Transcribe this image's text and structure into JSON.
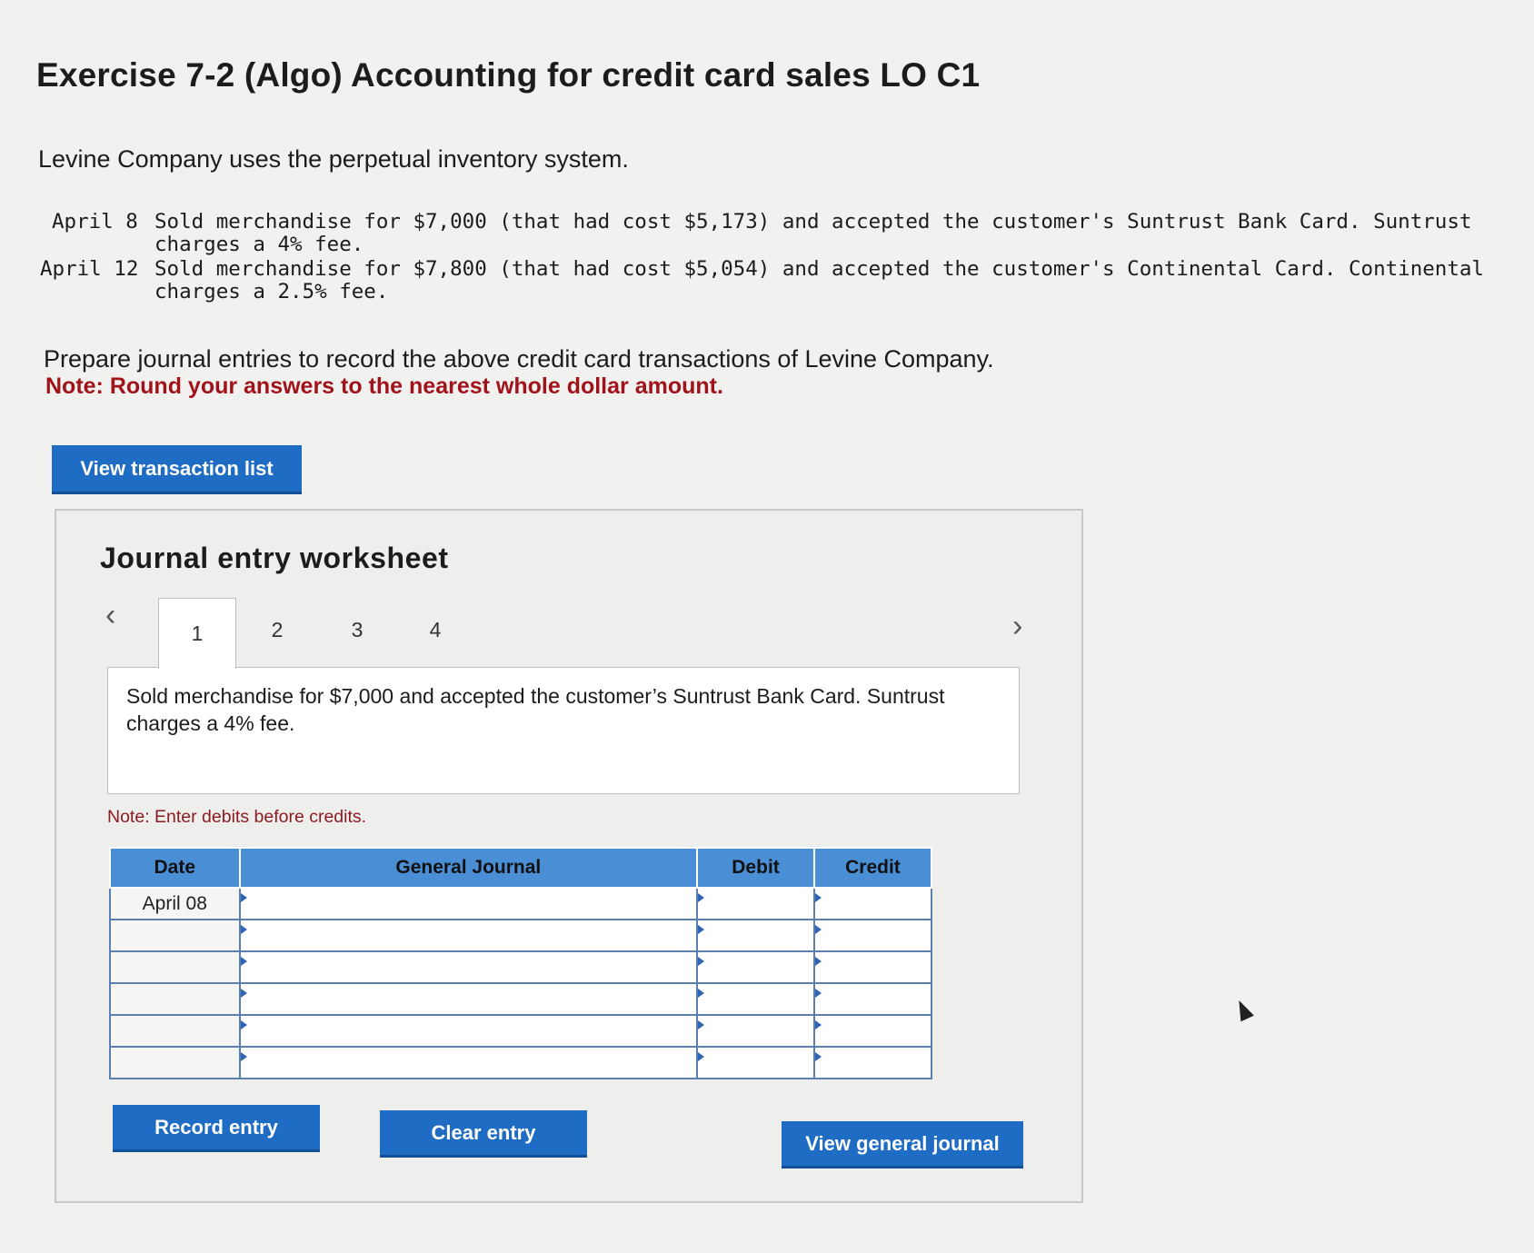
{
  "title": "Exercise 7-2 (Algo) Accounting for credit card sales LO C1",
  "intro": "Levine Company uses the perpetual inventory system.",
  "transactions": [
    {
      "date": "April 8",
      "line1": "Sold merchandise for $7,000 (that had cost $5,173) and accepted the customer's Suntrust Bank Card. Suntrust",
      "line2": "charges a 4% fee."
    },
    {
      "date": "April 12",
      "line1": "Sold merchandise for $7,800 (that had cost $5,054) and accepted the customer's Continental Card. Continental",
      "line2": "charges a 2.5% fee."
    }
  ],
  "prompt": "Prepare journal entries to record the above credit card transactions of Levine Company.",
  "rounding_note": "Note: Round your answers to the nearest whole dollar amount.",
  "buttons": {
    "view_transaction_list": "View transaction list",
    "record_entry": "Record entry",
    "clear_entry": "Clear entry",
    "view_general_journal": "View general journal"
  },
  "worksheet": {
    "title": "Journal entry worksheet",
    "prev_icon": "chevron-left-icon",
    "next_icon": "chevron-right-icon",
    "tabs": [
      "1",
      "2",
      "3",
      "4"
    ],
    "active_tab": "1",
    "description": "Sold merchandise for $7,000 and accepted the customer’s Suntrust Bank Card. Suntrust charges a 4% fee.",
    "note": "Note: Enter debits before credits.",
    "table": {
      "headers": {
        "date": "Date",
        "account": "General Journal",
        "debit": "Debit",
        "credit": "Credit"
      },
      "rows": [
        {
          "date": "April 08",
          "account": "",
          "debit": "",
          "credit": ""
        },
        {
          "date": "",
          "account": "",
          "debit": "",
          "credit": ""
        },
        {
          "date": "",
          "account": "",
          "debit": "",
          "credit": ""
        },
        {
          "date": "",
          "account": "",
          "debit": "",
          "credit": ""
        },
        {
          "date": "",
          "account": "",
          "debit": "",
          "credit": ""
        },
        {
          "date": "",
          "account": "",
          "debit": "",
          "credit": ""
        }
      ]
    }
  },
  "colors": {
    "accent_button": "#1f6cc4",
    "header_blue": "#4a8fd6",
    "note_red": "#a0131b"
  }
}
